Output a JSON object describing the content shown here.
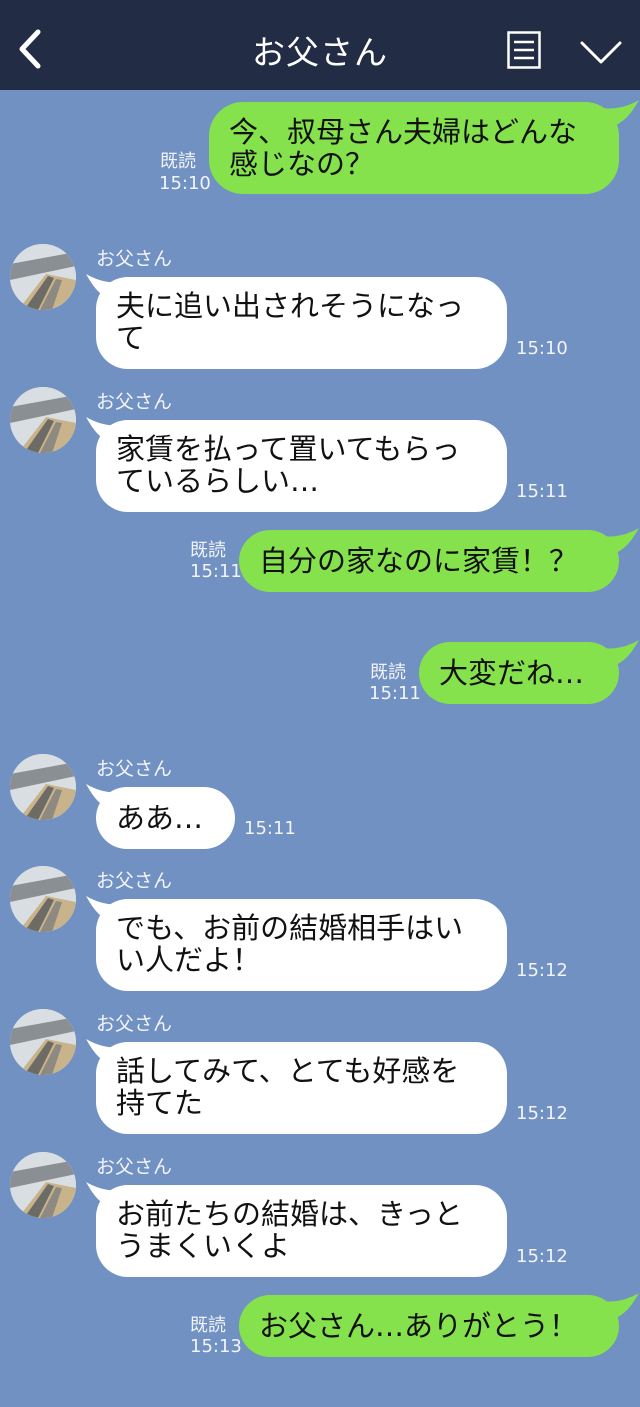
{
  "header": {
    "title": "お父さん",
    "back_icon": "chevron-left-icon",
    "menu_icon": "menu-icon",
    "down_icon": "chevron-down-icon",
    "bg": "#232c45"
  },
  "colors": {
    "background": "#7191c2",
    "out_bubble": "#85e14c",
    "in_bubble": "#ffffff"
  },
  "messages": [
    {
      "dir": "out",
      "text": "今、叔母さん夫婦はどんな\n感じなの？",
      "read": "既読",
      "time": "15:10"
    },
    {
      "dir": "in",
      "sender": "お父さん",
      "text": "夫に追い出されそうになっ\nて",
      "time": "15:10"
    },
    {
      "dir": "in",
      "sender": "お父さん",
      "text": "家賃を払って置いてもらっ\nているらしい…",
      "time": "15:11"
    },
    {
      "dir": "out",
      "text": "自分の家なのに家賃！？",
      "read": "既読",
      "time": "15:11"
    },
    {
      "dir": "out",
      "text": "大変だね…",
      "read": "既読",
      "time": "15:11"
    },
    {
      "dir": "in",
      "sender": "お父さん",
      "text": "ああ…",
      "time": "15:11"
    },
    {
      "dir": "in",
      "sender": "お父さん",
      "text": "でも、お前の結婚相手はい\nい人だよ！",
      "time": "15:12"
    },
    {
      "dir": "in",
      "sender": "お父さん",
      "text": "話してみて、とても好感を\n持てた",
      "time": "15:12"
    },
    {
      "dir": "in",
      "sender": "お父さん",
      "text": "お前たちの結婚は、きっと\nうまくいくよ",
      "time": "15:12"
    },
    {
      "dir": "out",
      "text": "お父さん…ありがとう！",
      "read": "既読",
      "time": "15:13"
    }
  ]
}
